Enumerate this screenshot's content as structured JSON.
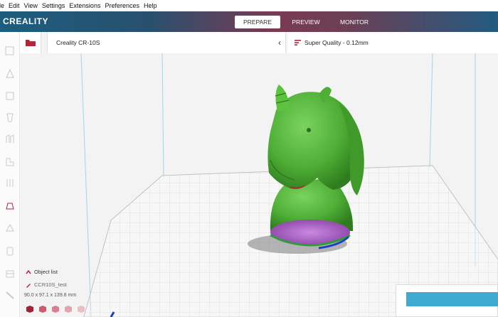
{
  "menu": [
    "File",
    "Edit",
    "View",
    "Settings",
    "Extensions",
    "Preferences",
    "Help"
  ],
  "menu_display": [
    "ile",
    "Edit",
    "View",
    "Settings",
    "Extensions",
    "Preferences",
    "Help"
  ],
  "brand": "CREALITY",
  "stages": [
    {
      "label": "PREPARE",
      "active": true
    },
    {
      "label": "PREVIEW",
      "active": false
    },
    {
      "label": "MONITOR",
      "active": false
    }
  ],
  "printer": {
    "name": "Creality CR-10S"
  },
  "quality": {
    "label": "Super Quality - 0.12mm"
  },
  "sidebar_tools": [
    "move-icon",
    "scale-icon",
    "rotate-icon",
    "mirror-icon",
    "per-model-settings-icon",
    "support-blocker-icon",
    "tool-7-icon",
    "tool-8-icon",
    "tool-9-icon",
    "tool-10-icon",
    "tool-11-icon",
    "tool-12-icon",
    "tool-13-icon"
  ],
  "object_list": {
    "title": "Object list",
    "item": "CCR10S_test",
    "dimensions": "90.0 x 97.1 x 139.8 mm"
  },
  "colors": {
    "model": "#52b83a",
    "accent": "#3ea9d1",
    "bed_overhang": "#9b4fb3",
    "brand_red": "#c0392b"
  }
}
